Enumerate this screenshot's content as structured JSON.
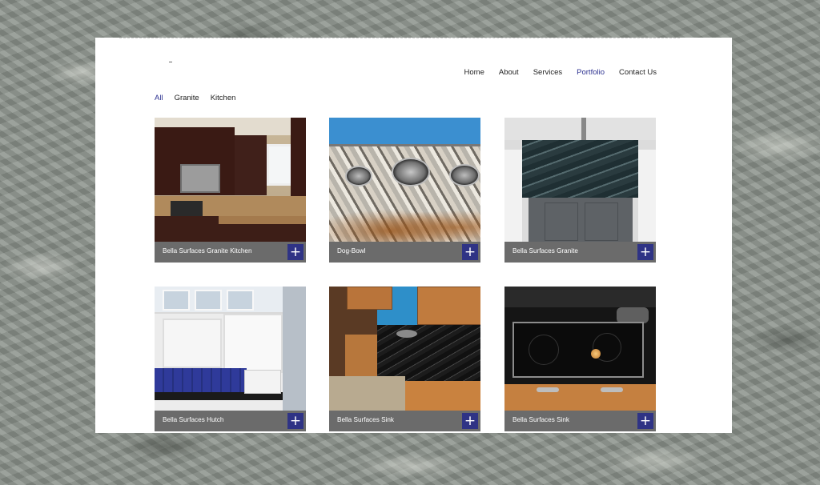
{
  "nav": {
    "items": [
      "Home",
      "About",
      "Services",
      "Portfolio",
      "Contact Us"
    ],
    "active": "Portfolio"
  },
  "filters": {
    "items": [
      "All",
      "Granite",
      "Kitchen"
    ],
    "active": "All"
  },
  "portfolio": {
    "items": [
      {
        "title": "Bella Surfaces Granite Kitchen",
        "expand_icon": "plus"
      },
      {
        "title": "Dog-Bowl",
        "expand_icon": "plus"
      },
      {
        "title": "Bella Surfaces Granite",
        "expand_icon": "plus"
      },
      {
        "title": "Bella Surfaces Hutch",
        "expand_icon": "plus"
      },
      {
        "title": "Bella Surfaces Sink",
        "expand_icon": "plus"
      },
      {
        "title": "Bella Surfaces Sink",
        "expand_icon": "plus"
      }
    ]
  },
  "colors": {
    "accent": "#2f3385",
    "caption_bar": "#6b6b6b",
    "active_link": "#2d3290"
  }
}
